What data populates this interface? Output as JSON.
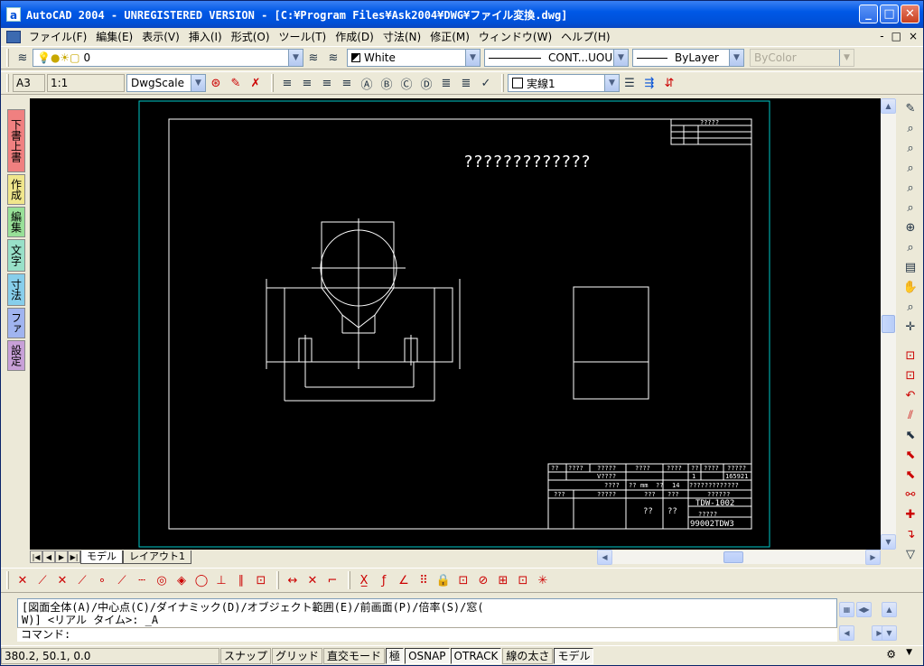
{
  "window": {
    "title": "AutoCAD 2004 - UNREGISTERED VERSION - [C:¥Program Files¥Ask2004¥DWG¥ファイル変換.dwg]",
    "app_icon_letter": "a"
  },
  "menu": [
    "ファイル(F)",
    "編集(E)",
    "表示(V)",
    "挿入(I)",
    "形式(O)",
    "ツール(T)",
    "作成(D)",
    "寸法(N)",
    "修正(M)",
    "ウィンドウ(W)",
    "ヘルプ(H)"
  ],
  "mdi_buttons": [
    "-",
    "□",
    "×"
  ],
  "toolbar1": {
    "layer_value": "0",
    "color_value": "White",
    "linetype_value": "CONT...UOUS",
    "lineweight_value": "ByLayer",
    "plotstyle_value": "ByColor"
  },
  "toolbar2": {
    "paper_size": "A3",
    "scale": "1:1",
    "dwgscale": "DwgScale",
    "linestyle": "実線1"
  },
  "side_tabs": [
    "下書上書",
    "作成",
    "編集",
    "文字",
    "寸法",
    "ファ",
    "設定"
  ],
  "side_tab_colors": [
    "#f08080",
    "#f0e68c",
    "#98e098",
    "#98e0c8",
    "#87ceeb",
    "#a0b4f0",
    "#c8a0d8"
  ],
  "drawing": {
    "heading": "?????????????",
    "small_table_header": "?????",
    "title_block": {
      "r1": [
        "??",
        "????",
        "?????",
        "????",
        "????",
        "??",
        "????",
        "?????"
      ],
      "r2": [
        "V????",
        "1",
        "165921"
      ],
      "r3": [
        "????",
        "??",
        "mm",
        "??",
        "14",
        "?????????????"
      ],
      "r4": [
        "???",
        "?????",
        "???",
        "???",
        "??????"
      ],
      "drawing_no": "TDW-1002",
      "sub_label": "?????",
      "mid_cells": [
        "??",
        "??"
      ],
      "file_no": "99002TDW3"
    }
  },
  "layout_tabs": [
    "モデル",
    "レイアウト1"
  ],
  "command": {
    "history_1": "[図面全体(A)/中心点(C)/ダイナミック(D)/オブジェクト範囲(E)/前画面(P)/倍率(S)/窓(",
    "history_2": "W)] <リアル タイム>: _A",
    "prompt": "コマンド:"
  },
  "status": {
    "coords": "380.2, 50.1, 0.0",
    "buttons": [
      "スナップ",
      "グリッド",
      "直交モード",
      "極",
      "OSNAP",
      "OTRACK",
      "線の太さ",
      "モデル"
    ],
    "on_states": [
      false,
      false,
      false,
      true,
      true,
      true,
      false,
      true
    ]
  }
}
